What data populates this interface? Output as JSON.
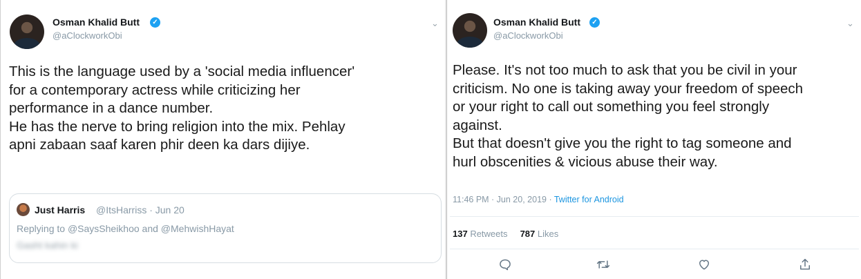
{
  "left": {
    "author": {
      "name": "Osman Khalid Butt",
      "handle": "@aClockworkObi"
    },
    "text_lines": [
      "This is the language used by a 'social media influencer'",
      "for a contemporary actress while criticizing her",
      "performance in a dance number.",
      "He has the nerve to bring religion into the mix. Pehlay",
      "apni zabaan saaf karen phir deen ka dars dijiye."
    ],
    "quote": {
      "name": "Just Harris",
      "handle_date": "@ItsHarriss · Jun 20",
      "replying_prefix": "Replying to ",
      "mention1": "@SaysSheikhoo",
      "and": " and ",
      "mention2": "@MehwishHayat",
      "blurred_text": "Gasht kahin ki"
    }
  },
  "right": {
    "author": {
      "name": "Osman Khalid Butt",
      "handle": "@aClockworkObi"
    },
    "text_lines": [
      "Please. It's not too much to ask that you be civil in your",
      "criticism. No one is taking away your freedom of speech",
      "or your right to call out something you feel strongly",
      "against.",
      "But that doesn't give you the right to tag someone and",
      "hurl obscenities & vicious abuse their way."
    ],
    "meta": {
      "time": "11:46 PM · Jun 20, 2019 · ",
      "source": "Twitter for Android"
    },
    "stats": {
      "retweets_count": "137",
      "retweets_label": " Retweets",
      "likes_count": "787",
      "likes_label": " Likes"
    }
  },
  "icons": {
    "verified": "verified-badge-icon",
    "chevron": "chevron-down-icon",
    "reply": "reply-icon",
    "retweet": "retweet-icon",
    "like": "heart-icon",
    "share": "share-icon"
  },
  "colors": {
    "verified": "#1da1f2",
    "link": "#1b95e0",
    "muted": "#8899a6"
  }
}
